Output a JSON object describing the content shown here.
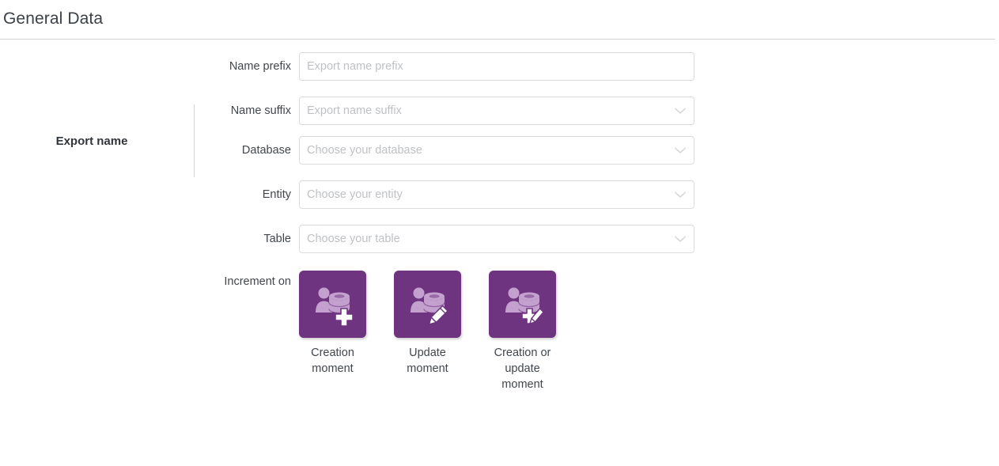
{
  "page": {
    "title": "General Data"
  },
  "export_section": {
    "title": "Export name"
  },
  "fields": {
    "name_prefix": {
      "label": "Name prefix",
      "placeholder": "Export name prefix",
      "value": ""
    },
    "name_suffix": {
      "label": "Name suffix",
      "placeholder": "Export name suffix",
      "value": ""
    },
    "database": {
      "label": "Database",
      "placeholder": "Choose your database",
      "value": ""
    },
    "entity": {
      "label": "Entity",
      "placeholder": "Choose your entity",
      "value": ""
    },
    "table": {
      "label": "Table",
      "placeholder": "Choose your table",
      "value": ""
    }
  },
  "increment_on": {
    "label": "Increment on",
    "options": [
      {
        "caption": "Creation moment",
        "icon": "user-database-add-icon"
      },
      {
        "caption": "Update moment",
        "icon": "user-database-edit-icon"
      },
      {
        "caption": "Creation or update moment",
        "icon": "user-database-add-edit-icon"
      }
    ]
  },
  "colors": {
    "tile_purple": "#6f3480",
    "tile_icon_light": "#c3a0ce",
    "tile_icon_white": "#ffffff",
    "border": "#dcdcdc",
    "placeholder": "#bfc1c4",
    "text": "#41464c"
  }
}
